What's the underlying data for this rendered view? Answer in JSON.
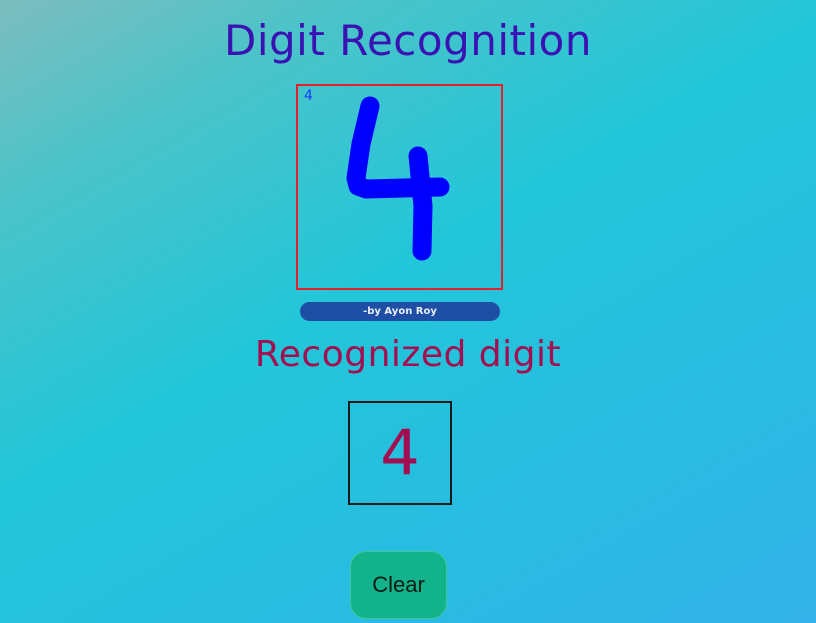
{
  "header": {
    "title": "Digit Recognition"
  },
  "canvas": {
    "mini_label": "4",
    "stroke_color": "#0000ff",
    "border_color": "#e4202a"
  },
  "credit": {
    "text": "-by Ayon Roy"
  },
  "result": {
    "label": "Recognized digit",
    "digit": "4"
  },
  "actions": {
    "clear_label": "Clear"
  },
  "colors": {
    "title": "#3a12b4",
    "result": "#a40d4f",
    "button": "#12b38a",
    "credit_bg": "#1e4fa5"
  }
}
